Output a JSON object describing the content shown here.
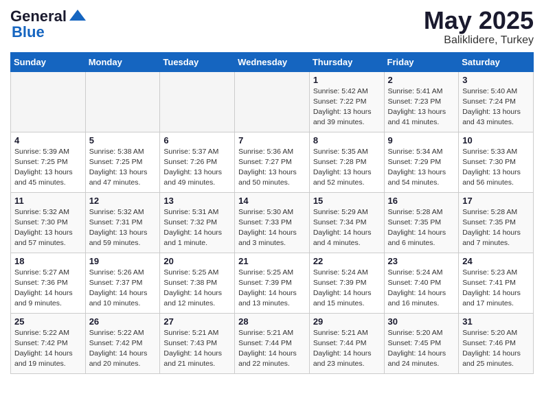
{
  "header": {
    "logo_general": "General",
    "logo_blue": "Blue",
    "month_title": "May 2025",
    "location": "Baliklidere, Turkey"
  },
  "days_of_week": [
    "Sunday",
    "Monday",
    "Tuesday",
    "Wednesday",
    "Thursday",
    "Friday",
    "Saturday"
  ],
  "weeks": [
    [
      {
        "day": "",
        "info": ""
      },
      {
        "day": "",
        "info": ""
      },
      {
        "day": "",
        "info": ""
      },
      {
        "day": "",
        "info": ""
      },
      {
        "day": "1",
        "info": "Sunrise: 5:42 AM\nSunset: 7:22 PM\nDaylight: 13 hours\nand 39 minutes."
      },
      {
        "day": "2",
        "info": "Sunrise: 5:41 AM\nSunset: 7:23 PM\nDaylight: 13 hours\nand 41 minutes."
      },
      {
        "day": "3",
        "info": "Sunrise: 5:40 AM\nSunset: 7:24 PM\nDaylight: 13 hours\nand 43 minutes."
      }
    ],
    [
      {
        "day": "4",
        "info": "Sunrise: 5:39 AM\nSunset: 7:25 PM\nDaylight: 13 hours\nand 45 minutes."
      },
      {
        "day": "5",
        "info": "Sunrise: 5:38 AM\nSunset: 7:25 PM\nDaylight: 13 hours\nand 47 minutes."
      },
      {
        "day": "6",
        "info": "Sunrise: 5:37 AM\nSunset: 7:26 PM\nDaylight: 13 hours\nand 49 minutes."
      },
      {
        "day": "7",
        "info": "Sunrise: 5:36 AM\nSunset: 7:27 PM\nDaylight: 13 hours\nand 50 minutes."
      },
      {
        "day": "8",
        "info": "Sunrise: 5:35 AM\nSunset: 7:28 PM\nDaylight: 13 hours\nand 52 minutes."
      },
      {
        "day": "9",
        "info": "Sunrise: 5:34 AM\nSunset: 7:29 PM\nDaylight: 13 hours\nand 54 minutes."
      },
      {
        "day": "10",
        "info": "Sunrise: 5:33 AM\nSunset: 7:30 PM\nDaylight: 13 hours\nand 56 minutes."
      }
    ],
    [
      {
        "day": "11",
        "info": "Sunrise: 5:32 AM\nSunset: 7:30 PM\nDaylight: 13 hours\nand 57 minutes."
      },
      {
        "day": "12",
        "info": "Sunrise: 5:32 AM\nSunset: 7:31 PM\nDaylight: 13 hours\nand 59 minutes."
      },
      {
        "day": "13",
        "info": "Sunrise: 5:31 AM\nSunset: 7:32 PM\nDaylight: 14 hours\nand 1 minute."
      },
      {
        "day": "14",
        "info": "Sunrise: 5:30 AM\nSunset: 7:33 PM\nDaylight: 14 hours\nand 3 minutes."
      },
      {
        "day": "15",
        "info": "Sunrise: 5:29 AM\nSunset: 7:34 PM\nDaylight: 14 hours\nand 4 minutes."
      },
      {
        "day": "16",
        "info": "Sunrise: 5:28 AM\nSunset: 7:35 PM\nDaylight: 14 hours\nand 6 minutes."
      },
      {
        "day": "17",
        "info": "Sunrise: 5:28 AM\nSunset: 7:35 PM\nDaylight: 14 hours\nand 7 minutes."
      }
    ],
    [
      {
        "day": "18",
        "info": "Sunrise: 5:27 AM\nSunset: 7:36 PM\nDaylight: 14 hours\nand 9 minutes."
      },
      {
        "day": "19",
        "info": "Sunrise: 5:26 AM\nSunset: 7:37 PM\nDaylight: 14 hours\nand 10 minutes."
      },
      {
        "day": "20",
        "info": "Sunrise: 5:25 AM\nSunset: 7:38 PM\nDaylight: 14 hours\nand 12 minutes."
      },
      {
        "day": "21",
        "info": "Sunrise: 5:25 AM\nSunset: 7:39 PM\nDaylight: 14 hours\nand 13 minutes."
      },
      {
        "day": "22",
        "info": "Sunrise: 5:24 AM\nSunset: 7:39 PM\nDaylight: 14 hours\nand 15 minutes."
      },
      {
        "day": "23",
        "info": "Sunrise: 5:24 AM\nSunset: 7:40 PM\nDaylight: 14 hours\nand 16 minutes."
      },
      {
        "day": "24",
        "info": "Sunrise: 5:23 AM\nSunset: 7:41 PM\nDaylight: 14 hours\nand 17 minutes."
      }
    ],
    [
      {
        "day": "25",
        "info": "Sunrise: 5:22 AM\nSunset: 7:42 PM\nDaylight: 14 hours\nand 19 minutes."
      },
      {
        "day": "26",
        "info": "Sunrise: 5:22 AM\nSunset: 7:42 PM\nDaylight: 14 hours\nand 20 minutes."
      },
      {
        "day": "27",
        "info": "Sunrise: 5:21 AM\nSunset: 7:43 PM\nDaylight: 14 hours\nand 21 minutes."
      },
      {
        "day": "28",
        "info": "Sunrise: 5:21 AM\nSunset: 7:44 PM\nDaylight: 14 hours\nand 22 minutes."
      },
      {
        "day": "29",
        "info": "Sunrise: 5:21 AM\nSunset: 7:44 PM\nDaylight: 14 hours\nand 23 minutes."
      },
      {
        "day": "30",
        "info": "Sunrise: 5:20 AM\nSunset: 7:45 PM\nDaylight: 14 hours\nand 24 minutes."
      },
      {
        "day": "31",
        "info": "Sunrise: 5:20 AM\nSunset: 7:46 PM\nDaylight: 14 hours\nand 25 minutes."
      }
    ]
  ]
}
